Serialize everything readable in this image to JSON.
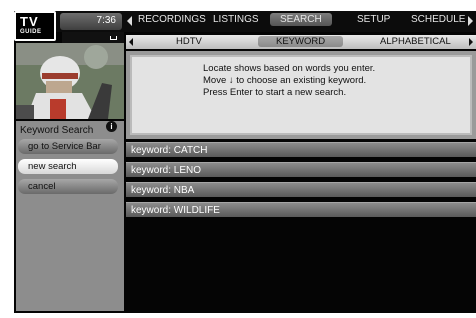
{
  "logo": {
    "tv": "TV",
    "guide": "GUIDE"
  },
  "header": {
    "clock": "7:36",
    "nav": [
      {
        "label": "RECORDINGS",
        "selected": false
      },
      {
        "label": "LISTINGS",
        "selected": false
      },
      {
        "label": "SEARCH",
        "selected": true
      },
      {
        "label": "SETUP",
        "selected": false
      },
      {
        "label": "SCHEDULE",
        "selected": false
      }
    ]
  },
  "subtabs": [
    {
      "label": "HDTV",
      "selected": false
    },
    {
      "label": "KEYWORD",
      "selected": true
    },
    {
      "label": "ALPHABETICAL",
      "selected": false
    }
  ],
  "info": {
    "lines": [
      "Locate shows based on words you enter.",
      "Move ↓ to choose an existing keyword.",
      "Press Enter to start a new search."
    ]
  },
  "side_panel": {
    "title": "Keyword Search",
    "info_icon": "i",
    "menu": [
      {
        "label": "go to Service Bar",
        "selected": false
      },
      {
        "label": "new search",
        "selected": true
      },
      {
        "label": "cancel",
        "selected": false
      }
    ]
  },
  "keywords": [
    "keyword: CATCH",
    "keyword: LENO",
    "keyword: NBA",
    "keyword: WILDLIFE"
  ],
  "icons": {
    "lock": "lock-icon",
    "info": "info-icon",
    "nav_left": "arrow-left-icon",
    "nav_right": "arrow-right-icon"
  },
  "colors": {
    "background": "#050505",
    "panel": "#8d8d8d",
    "selected_button": "#ffffff"
  }
}
